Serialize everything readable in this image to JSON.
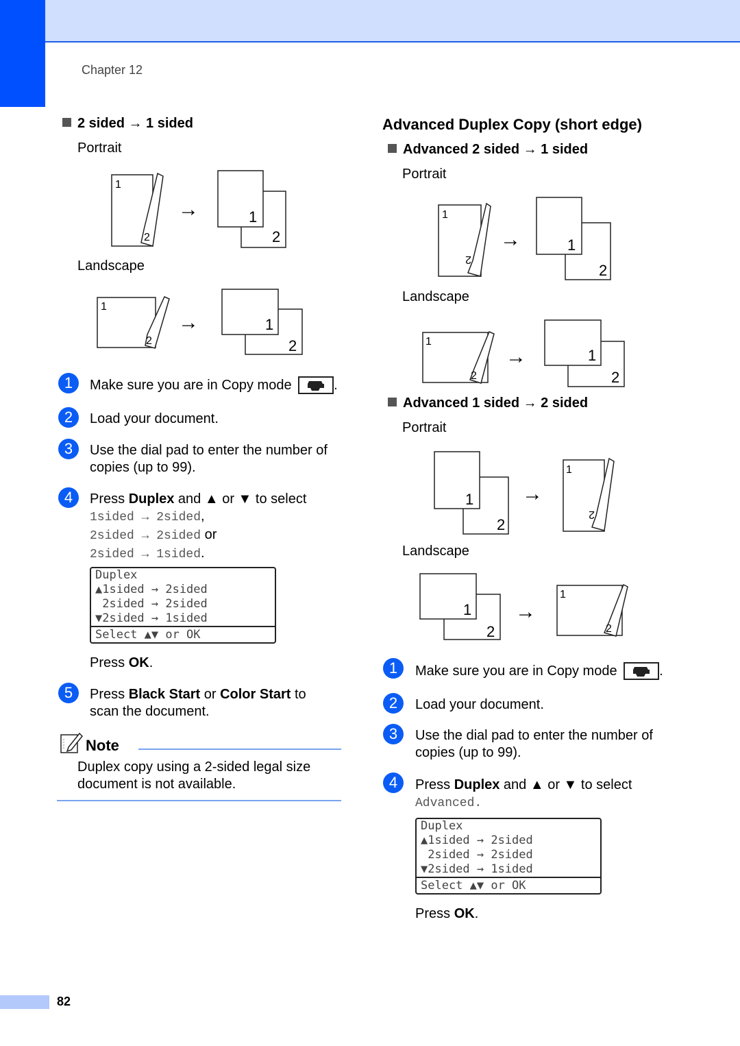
{
  "header": {
    "chapter": "Chapter 12"
  },
  "left": {
    "section": {
      "title": "2 sided → 1 sided",
      "portrait_label": "Portrait",
      "landscape_label": "Landscape"
    },
    "steps": [
      {
        "num": "1",
        "text": "Make sure you are in Copy mode",
        "after": "."
      },
      {
        "num": "2",
        "text": "Load your document."
      },
      {
        "num": "3",
        "line1": "Use the dial pad to enter the number of",
        "line2": "copies (up to 99)."
      },
      {
        "num": "4",
        "pre": "Press ",
        "bold": "Duplex",
        "post": " and ▲ or ▼ to select",
        "opt1": "1sided → 2sided",
        "opt1_tail": ",",
        "opt2": "2sided → 2sided",
        "opt2_tail": " or",
        "opt3": "2sided → 1sided",
        "opt3_tail": "."
      },
      {
        "num": "5",
        "pre": "Press ",
        "bold1": "Black Start",
        "mid": " or ",
        "bold2": "Color Start",
        "post": " to",
        "line2": "scan the document."
      }
    ],
    "press_ok": {
      "pre": "Press ",
      "bold": "OK",
      "post": "."
    },
    "note": {
      "title": "Note",
      "line1": "Duplex copy using a 2-sided legal size",
      "line2": "document is not available."
    }
  },
  "lcd": {
    "title": "Duplex",
    "row1": "▲1sided → 2sided",
    "row2": " 2sided → 2sided",
    "row3": "▼2sided → 1sided",
    "footer": "Select ▲▼ or OK"
  },
  "right": {
    "heading": "Advanced Duplex Copy (short edge)",
    "sec1": {
      "title": "Advanced 2 sided → 1 sided",
      "portrait_label": "Portrait",
      "landscape_label": "Landscape"
    },
    "sec2": {
      "title": "Advanced 1 sided → 2 sided",
      "portrait_label": "Portrait",
      "landscape_label": "Landscape"
    },
    "steps": [
      {
        "num": "1",
        "text": "Make sure you are in Copy mode",
        "after": "."
      },
      {
        "num": "2",
        "text": "Load your document."
      },
      {
        "num": "3",
        "line1": "Use the dial pad to enter the number of",
        "line2": "copies (up to 99)."
      },
      {
        "num": "4",
        "pre": "Press ",
        "bold": "Duplex",
        "post": " and ▲ or ▼ to select",
        "opt": "Advanced",
        "opt_tail": "."
      }
    ],
    "press_ok": {
      "pre": "Press ",
      "bold": "OK",
      "post": "."
    }
  },
  "diagram": {
    "page1": "1",
    "page2": "2",
    "arrow": "→"
  },
  "footer": {
    "page_number": "82"
  },
  "colors": {
    "accent_blue": "#0050ff",
    "band": "#cfdffd",
    "step_circle": "#0a5cf5"
  }
}
